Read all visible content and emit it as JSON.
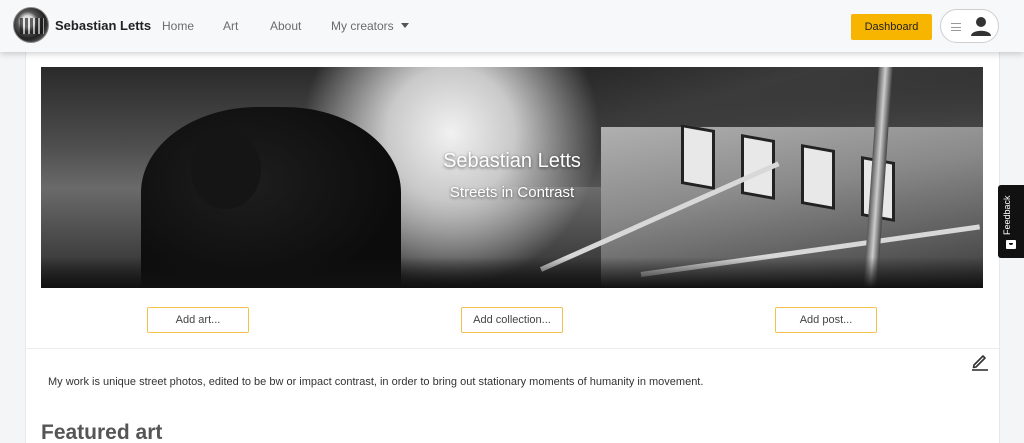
{
  "navbar": {
    "brand_name": "Sebastian Letts",
    "links": [
      "Home",
      "Art",
      "About",
      "My creators"
    ],
    "dashboard_label": "Dashboard"
  },
  "profile": {
    "banner_title": "Sebastian Letts",
    "banner_subtitle": "Streets in Contrast",
    "actions": [
      "Add art...",
      "Add collection...",
      "Add post..."
    ],
    "bio": "My work is unique street photos, edited to be bw or impact contrast, in order to bring out stationary moments of humanity in movement.",
    "featured_heading": "Featured art"
  },
  "feedback": {
    "label": "Feedback"
  },
  "colors": {
    "accent": "#f7b500",
    "button_border": "#f2c14e",
    "feedback_bg": "#111111"
  },
  "icons": [
    "brand-logo",
    "chevron-down-icon",
    "hamburger-icon",
    "user-icon",
    "pencil-icon",
    "feedback-icon"
  ]
}
